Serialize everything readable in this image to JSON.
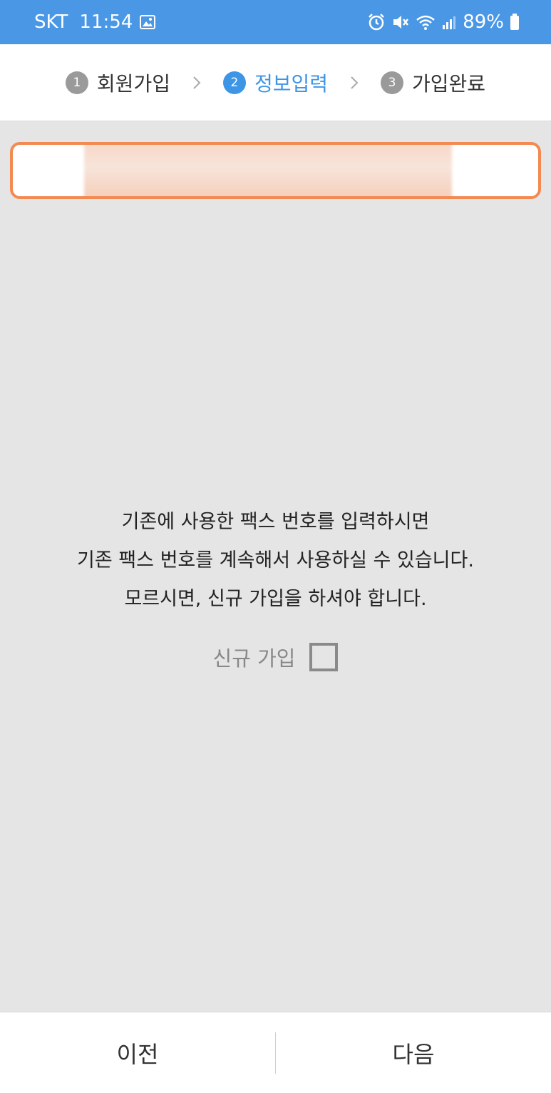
{
  "status_bar": {
    "carrier": "SKT",
    "time": "11:54",
    "battery": "89%",
    "icons": [
      "image-icon",
      "alarm-icon",
      "mute-icon",
      "wifi-icon",
      "signal-icon",
      "battery-icon"
    ]
  },
  "stepper": {
    "steps": [
      {
        "num": "1",
        "label": "회원가입",
        "active": false
      },
      {
        "num": "2",
        "label": "정보입력",
        "active": true
      },
      {
        "num": "3",
        "label": "가입완료",
        "active": false
      }
    ]
  },
  "message": {
    "line1": "기존에 사용한 팩스 번호를 입력하시면",
    "line2": "기존 팩스 번호를 계속해서 사용하실 수 있습니다.",
    "line3": "모르시면, 신규 가입을 하셔야 합니다."
  },
  "new_join": {
    "label": "신규 가입",
    "checked": false
  },
  "buttons": {
    "prev": "이전",
    "next": "다음"
  },
  "colors": {
    "status_bar": "#4a97e6",
    "accent": "#3d95e6",
    "input_border": "#f28a52",
    "background": "#e5e5e5"
  }
}
